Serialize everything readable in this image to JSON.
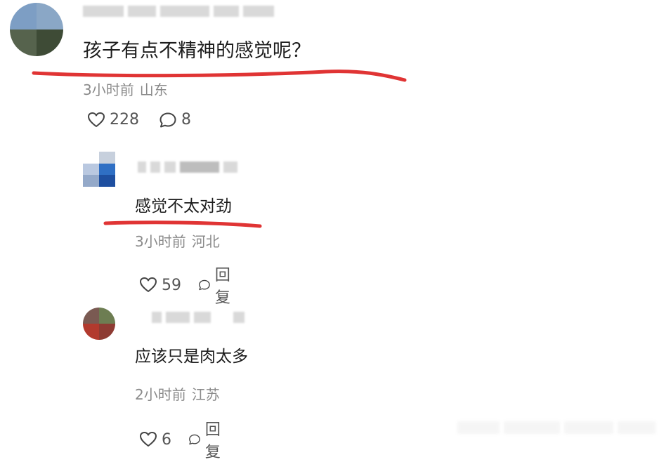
{
  "comments": [
    {
      "text": "孩子有点不精神的感觉呢？",
      "time": "3小时前",
      "location": "山东",
      "likes": "228",
      "replies": "8",
      "avatar_colors": [
        "#6b8fb8",
        "#5d6b55",
        "#3c4a35",
        "#8ca0b4"
      ],
      "underline_color": "#e03434"
    },
    {
      "text": "感觉不太对劲",
      "time": "3小时前",
      "location": "河北",
      "likes": "59",
      "reply_label": "回复",
      "avatar_colors": [
        "#c9d3e2",
        "#2f6fc4",
        "#1e4fa0",
        "#9fb6d9"
      ],
      "underline_color": "#e03434"
    },
    {
      "text": "应该只是肉太多",
      "time": "2小时前",
      "location": "江苏",
      "likes": "6",
      "reply_label": "回复",
      "avatar_colors": [
        "#8a5a4a",
        "#5e7a4a",
        "#b23a2e",
        "#d9c9a8"
      ]
    }
  ]
}
